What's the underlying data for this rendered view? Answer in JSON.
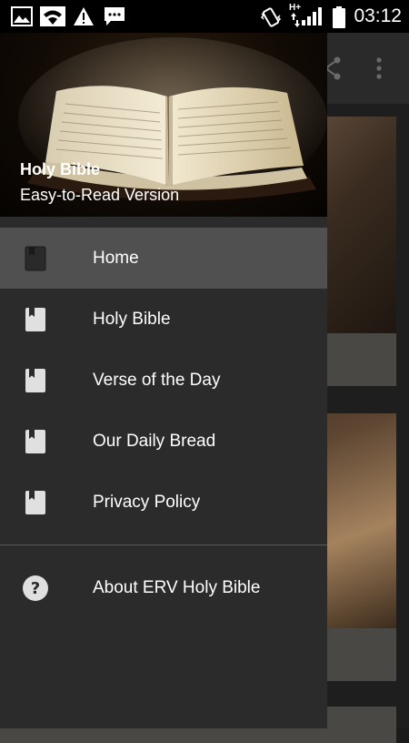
{
  "status_bar": {
    "time": "03:12",
    "network_label": "H+",
    "icons": [
      "image-icon",
      "wifi-icon",
      "warning-icon",
      "chat-icon",
      "vibrate-icon",
      "signal-icon",
      "battery-icon"
    ]
  },
  "drawer": {
    "header": {
      "title": "Holy Bible",
      "subtitle": "Easy-to-Read Version"
    },
    "items": [
      {
        "label": "Home",
        "icon": "book-icon",
        "active": true
      },
      {
        "label": "Holy Bible",
        "icon": "book-icon",
        "active": false
      },
      {
        "label": "Verse of the Day",
        "icon": "book-icon",
        "active": false
      },
      {
        "label": "Our Daily Bread",
        "icon": "book-icon",
        "active": false
      },
      {
        "label": "Privacy Policy",
        "icon": "book-icon",
        "active": false
      }
    ],
    "about": {
      "label": "About ERV Holy Bible",
      "icon": "help-icon"
    }
  },
  "background_app": {
    "toolbar_icons": [
      "share-icon",
      "more-vert-icon"
    ]
  },
  "colors": {
    "drawer_bg": "#2b2b2b",
    "active_item_bg": "#505050",
    "text": "#ffffff"
  }
}
